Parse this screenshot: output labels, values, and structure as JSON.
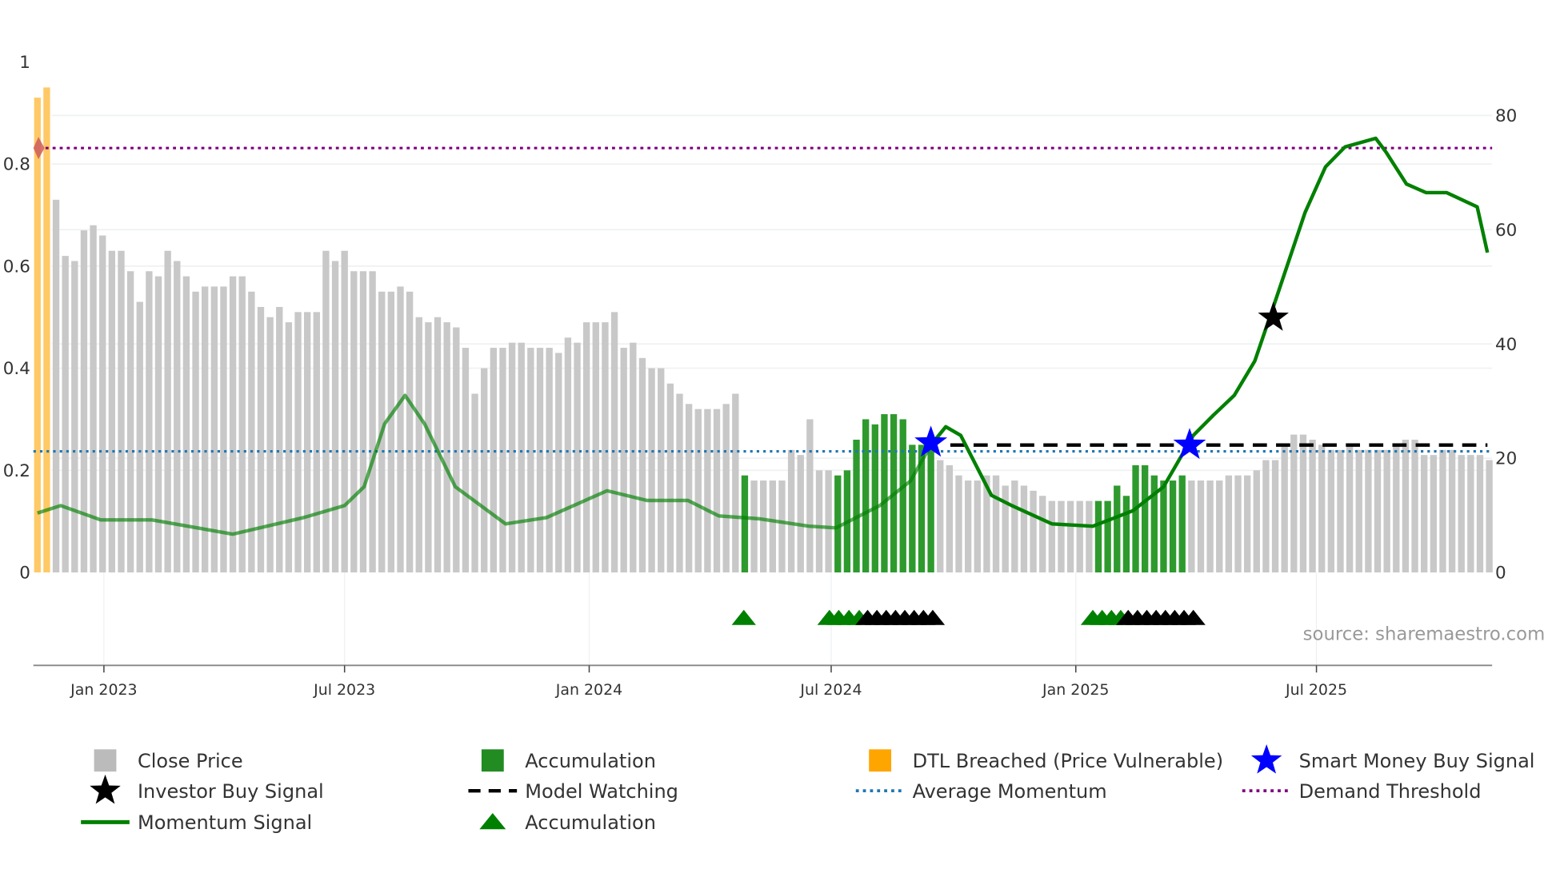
{
  "chart_data": {
    "type": "bar",
    "title": "",
    "start_date": "2022-11-12",
    "frequency": "weekly",
    "left_axis": {
      "ticks": [
        "0",
        "0.2",
        "0.4",
        "0.6",
        "0.8",
        "1"
      ],
      "tick_values": [
        0,
        0.2,
        0.4,
        0.6,
        0.8,
        1
      ],
      "ylim": [
        0,
        1
      ]
    },
    "right_axis": {
      "ticks": [
        "0",
        "20",
        "40",
        "60",
        "80"
      ],
      "tick_values": [
        0,
        20,
        40,
        60,
        80
      ],
      "ylim": [
        0,
        89
      ]
    },
    "x_ticks": [
      {
        "label": "Jan 2023",
        "date": "2023-01-01"
      },
      {
        "label": "Jul 2023",
        "date": "2023-07-01"
      },
      {
        "label": "Jan 2024",
        "date": "2024-01-01"
      },
      {
        "label": "Jul 2024",
        "date": "2024-07-01"
      },
      {
        "label": "Jan 2025",
        "date": "2025-01-01"
      },
      {
        "label": "Jul 2025",
        "date": "2025-07-01"
      }
    ],
    "close_price": [
      0.93,
      0.95,
      0.73,
      0.62,
      0.61,
      0.67,
      0.68,
      0.66,
      0.63,
      0.63,
      0.59,
      0.53,
      0.59,
      0.58,
      0.63,
      0.61,
      0.58,
      0.55,
      0.56,
      0.56,
      0.56,
      0.58,
      0.58,
      0.55,
      0.52,
      0.5,
      0.52,
      0.49,
      0.51,
      0.51,
      0.51,
      0.63,
      0.61,
      0.63,
      0.59,
      0.59,
      0.59,
      0.55,
      0.55,
      0.56,
      0.55,
      0.5,
      0.49,
      0.5,
      0.49,
      0.48,
      0.44,
      0.35,
      0.4,
      0.44,
      0.44,
      0.45,
      0.45,
      0.44,
      0.44,
      0.44,
      0.43,
      0.46,
      0.45,
      0.49,
      0.49,
      0.49,
      0.51,
      0.44,
      0.45,
      0.42,
      0.4,
      0.4,
      0.37,
      0.35,
      0.33,
      0.32,
      0.32,
      0.32,
      0.33,
      0.35,
      0.19,
      0.18,
      0.18,
      0.18,
      0.18,
      0.24,
      0.23,
      0.3,
      0.2,
      0.2,
      0.19,
      0.2,
      0.26,
      0.3,
      0.29,
      0.31,
      0.31,
      0.3,
      0.25,
      0.25,
      0.25,
      0.22,
      0.21,
      0.19,
      0.18,
      0.18,
      0.19,
      0.19,
      0.17,
      0.18,
      0.17,
      0.16,
      0.15,
      0.14,
      0.14,
      0.14,
      0.14,
      0.14,
      0.14,
      0.14,
      0.17,
      0.15,
      0.21,
      0.21,
      0.19,
      0.18,
      0.18,
      0.19,
      0.18,
      0.18,
      0.18,
      0.18,
      0.19,
      0.19,
      0.19,
      0.2,
      0.22,
      0.22,
      0.25,
      0.27,
      0.27,
      0.26,
      0.25,
      0.24,
      0.24,
      0.25,
      0.24,
      0.24,
      0.24,
      0.24,
      0.25,
      0.26,
      0.26,
      0.23,
      0.23,
      0.24,
      0.24,
      0.23,
      0.23,
      0.23,
      0.22
    ],
    "bar_state": {
      "dtl_breached_indices": [
        0,
        1
      ],
      "accumulation_ranges": [
        [
          76,
          76
        ],
        [
          86,
          96
        ],
        [
          114,
          123
        ]
      ]
    },
    "momentum_signal": [
      [
        0,
        10.4
      ],
      [
        2.5,
        11.7
      ],
      [
        6.8,
        9.2
      ],
      [
        12.3,
        9.2
      ],
      [
        21,
        6.7
      ],
      [
        28.6,
        9.6
      ],
      [
        33,
        11.7
      ],
      [
        35.1,
        15
      ],
      [
        37.3,
        26
      ],
      [
        39.5,
        31
      ],
      [
        41.6,
        26
      ],
      [
        44.9,
        15
      ],
      [
        50.3,
        8.5
      ],
      [
        54.7,
        9.6
      ],
      [
        61.2,
        14.3
      ],
      [
        65.5,
        12.6
      ],
      [
        69.9,
        12.6
      ],
      [
        73.2,
        9.9
      ],
      [
        77.5,
        9.4
      ],
      [
        82.9,
        8.1
      ],
      [
        85.8,
        7.8
      ],
      [
        90.5,
        11.7
      ],
      [
        93.8,
        16
      ],
      [
        96,
        22.3
      ],
      [
        97.6,
        25.5
      ],
      [
        99.2,
        24
      ],
      [
        102.5,
        13.5
      ],
      [
        104.7,
        11.7
      ],
      [
        109,
        8.5
      ],
      [
        113.4,
        8.1
      ],
      [
        117.7,
        10.8
      ],
      [
        121,
        15
      ],
      [
        124.2,
        24
      ],
      [
        126.4,
        27.6
      ],
      [
        128.6,
        31
      ],
      [
        130.8,
        37
      ],
      [
        132.9,
        47
      ],
      [
        136.2,
        63
      ],
      [
        138.4,
        71
      ],
      [
        140.5,
        74.5
      ],
      [
        143.8,
        76
      ],
      [
        144.9,
        73.6
      ],
      [
        147.1,
        68
      ],
      [
        149.2,
        66.5
      ],
      [
        151.4,
        66.5
      ],
      [
        154.7,
        64
      ],
      [
        155.8,
        56
      ]
    ],
    "average_momentum": 21.2,
    "demand_threshold": 74.3,
    "model_watching": {
      "value": 22.3,
      "from_index": 97,
      "to_index": 155.8
    },
    "smart_money_buy_signals": [
      [
        96,
        22.7
      ],
      [
        123.8,
        22.3
      ]
    ],
    "investor_buy_signals": [
      [
        132.8,
        44.6
      ]
    ],
    "accumulation_markers_green": [
      75.9,
      85.1,
      86.1,
      87.2,
      88.3,
      113.4,
      114.4,
      115.4,
      116.4
    ],
    "accumulation_markers_black": [
      89.2,
      90.2,
      91.2,
      92.2,
      93.2,
      94.2,
      95.2,
      96.2,
      117.2,
      118.2,
      119.2,
      120.2,
      121.2,
      122.2,
      123.2,
      124.2
    ],
    "legend": [
      {
        "label": "Close Price",
        "symbol": "square",
        "color": "#bbbbbb"
      },
      {
        "label": "Accumulation",
        "symbol": "square",
        "color": "#228b22"
      },
      {
        "label": "DTL Breached (Price Vulnerable)",
        "symbol": "square",
        "color": "#ffa500"
      },
      {
        "label": "Smart Money Buy Signal",
        "symbol": "star",
        "color": "#0000ff"
      },
      {
        "label": "Investor Buy Signal",
        "symbol": "star",
        "color": "#000000"
      },
      {
        "label": "Model Watching",
        "symbol": "dash",
        "color": "#000000"
      },
      {
        "label": "Average Momentum",
        "symbol": "dot",
        "color": "#1f77b4"
      },
      {
        "label": "Demand Threshold",
        "symbol": "dot",
        "color": "#800080"
      },
      {
        "label": "Momentum Signal",
        "symbol": "line",
        "color": "#008000"
      },
      {
        "label": "Accumulation",
        "symbol": "triangle",
        "color": "#008000"
      }
    ],
    "source": "source: sharemaestro.com"
  },
  "colors": {
    "gray": "#c8c8c8",
    "accumulation": "#2e9a2e",
    "dtl": "#ffc966",
    "momentum": "#008000",
    "avg": "#1f77b4",
    "demand": "#800080",
    "threshold_marker": "#cd5c5c"
  }
}
